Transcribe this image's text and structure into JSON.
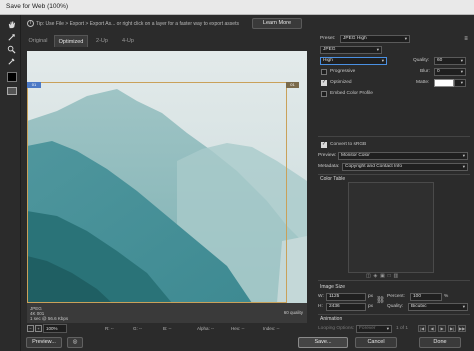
{
  "window": {
    "title": "Save for Web (100%)"
  },
  "tip": {
    "text": "Tip: Use File > Export > Export As... or right click on a layer for a faster way to export assets",
    "learn_more": "Learn More"
  },
  "tabs": [
    {
      "label": "Original",
      "active": false
    },
    {
      "label": "Optimized",
      "active": true
    },
    {
      "label": "2-Up",
      "active": false
    },
    {
      "label": "4-Up",
      "active": false
    }
  ],
  "tools": [
    "hand-icon",
    "slice-select-icon",
    "zoom-icon",
    "eyedropper-icon"
  ],
  "canvas": {
    "slice_tag_left": "01",
    "slice_tag_right": "01"
  },
  "image_info": {
    "format": "JPEG",
    "size": "4K 001",
    "time": "1 sec @ 56.6 Kbps",
    "quality": "60 quality"
  },
  "status": {
    "zoom": "100%",
    "r": "R: --",
    "g": "G: --",
    "b": "B: --",
    "alpha": "Alpha: --",
    "hex": "Hex: --",
    "index": "Index: --"
  },
  "buttons": {
    "preview": "Preview...",
    "save": "Save...",
    "cancel": "Cancel",
    "done": "Done"
  },
  "settings": {
    "preset_label": "Preset:",
    "preset_value": "JPEG High",
    "format_value": "JPEG",
    "quality_level": "High",
    "quality_label": "Quality:",
    "quality_value": "60",
    "blur_label": "Blur:",
    "blur_value": "0",
    "matte_label": "Matte:",
    "progressive_label": "Progressive",
    "progressive": false,
    "optimized_label": "Optimized",
    "optimized": true,
    "embed_profile_label": "Embed Color Profile",
    "embed_profile": false,
    "srgb_label": "Convert to sRGB",
    "srgb": true,
    "preview_label": "Preview:",
    "preview_value": "Monitor Color",
    "metadata_label": "Metadata:",
    "metadata_value": "Copyright and Contact Info",
    "color_table_title": "Color Table",
    "image_size_title": "Image Size",
    "width_label": "W:",
    "width_value": "1125",
    "height_label": "H:",
    "height_value": "2436",
    "unit": "px",
    "percent_label": "Percent:",
    "percent_value": "100",
    "percent_unit": "%",
    "resample_label": "Quality:",
    "resample_value": "Bicubic",
    "animation_title": "Animation",
    "looping_label": "Looping Options:",
    "looping_value": "Forever",
    "frame_counter": "1 of 1"
  }
}
